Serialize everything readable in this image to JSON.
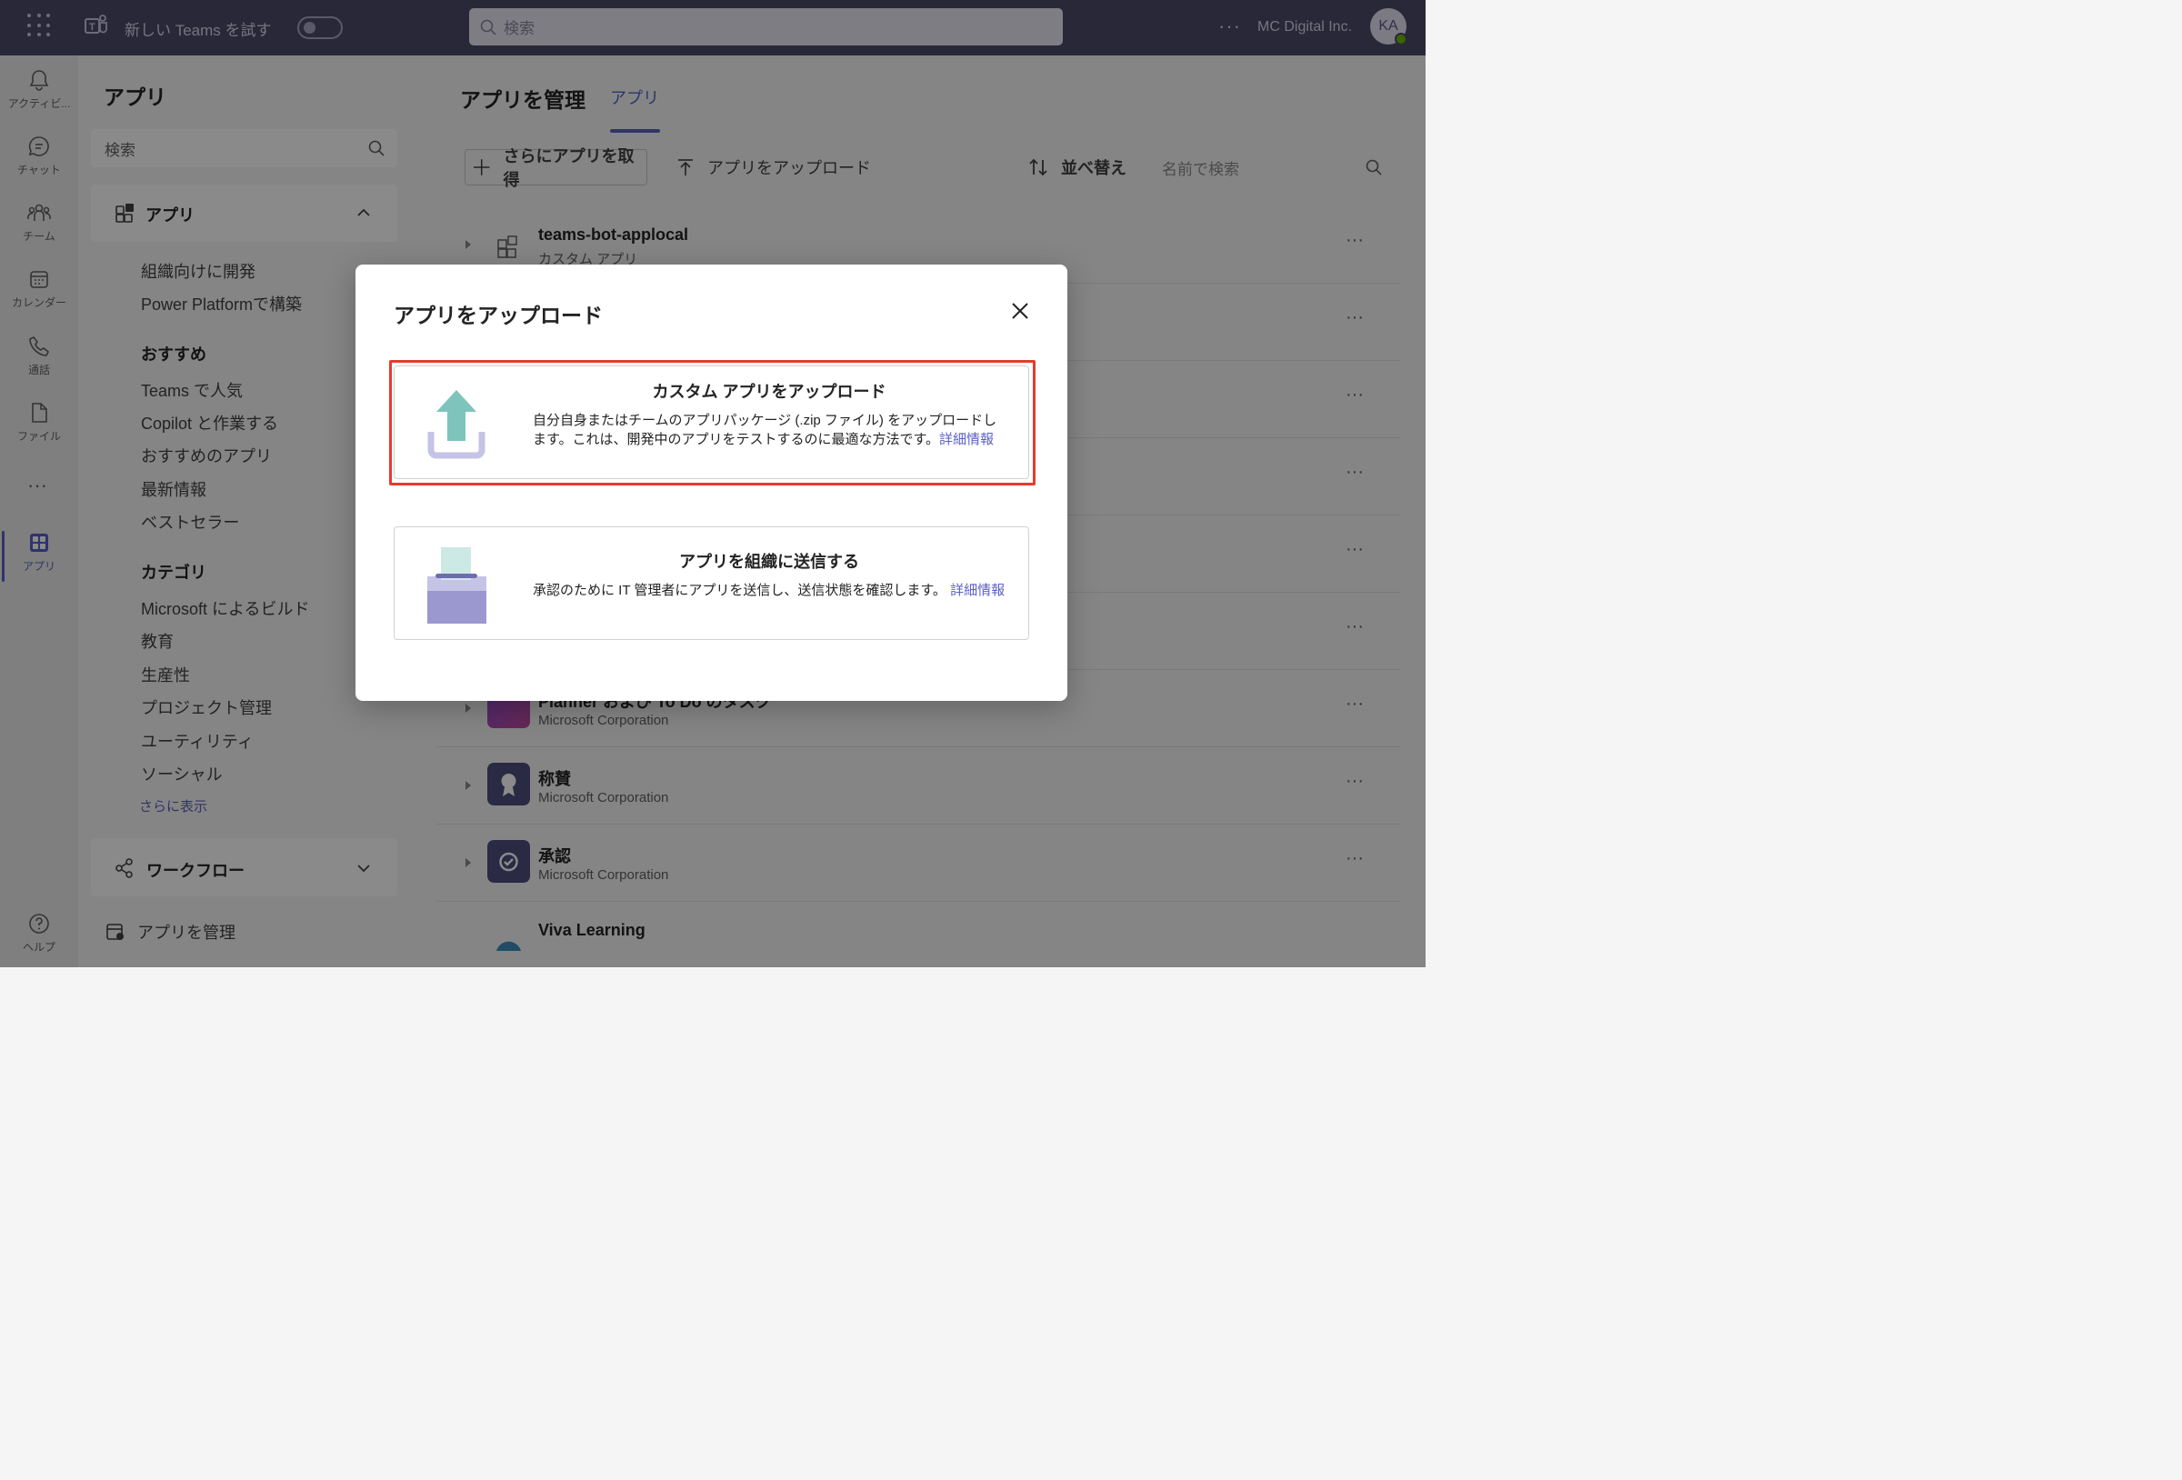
{
  "topbar": {
    "try_label": "新しい Teams を試す",
    "search_placeholder": "検索",
    "more": "···",
    "org_name": "MC Digital Inc.",
    "avatar_initials": "KA"
  },
  "rail": {
    "items": [
      {
        "label": "アクティビ...",
        "icon": "bell-icon"
      },
      {
        "label": "チャット",
        "icon": "chat-icon"
      },
      {
        "label": "チーム",
        "icon": "teams-icon"
      },
      {
        "label": "カレンダー",
        "icon": "calendar-icon"
      },
      {
        "label": "通話",
        "icon": "phone-icon"
      },
      {
        "label": "ファイル",
        "icon": "file-icon"
      },
      {
        "label": "アプリ",
        "icon": "apps-icon"
      }
    ],
    "more": "···",
    "help": "ヘルプ"
  },
  "leftpanel": {
    "title": "アプリ",
    "search_placeholder": "検索",
    "apps_section": "アプリ",
    "links_top": [
      "組織向けに開発",
      "Power Platformで構築"
    ],
    "recommended_heading": "おすすめ",
    "recommended": [
      "Teams で人気",
      "Copilot と作業する",
      "おすすめのアプリ",
      "最新情報",
      "ベストセラー"
    ],
    "category_heading": "カテゴリ",
    "categories": [
      "Microsoft によるビルド",
      "教育",
      "生産性",
      "プロジェクト管理",
      "ユーティリティ",
      "ソーシャル"
    ],
    "show_more": "さらに表示",
    "workflow": "ワークフロー",
    "manage": "アプリを管理"
  },
  "main": {
    "title": "アプリを管理",
    "tab": "アプリ",
    "get_more": "さらにアプリを取得",
    "upload": "アプリをアップロード",
    "sort": "並べ替え",
    "search_placeholder": "名前で検索",
    "rows": [
      {
        "name": "teams-bot-applocal",
        "sub": "カスタム アプリ"
      },
      {
        "name": "",
        "sub": ""
      },
      {
        "name": "",
        "sub": ""
      },
      {
        "name": "",
        "sub": ""
      },
      {
        "name": "",
        "sub": ""
      },
      {
        "name": "",
        "sub": ""
      },
      {
        "name": "Planner および To Do のタスク",
        "sub": "Microsoft Corporation"
      },
      {
        "name": "称賛",
        "sub": "Microsoft Corporation"
      },
      {
        "name": "承認",
        "sub": "Microsoft Corporation"
      },
      {
        "name": "Viva Learning",
        "sub": ""
      }
    ]
  },
  "dialog": {
    "title": "アプリをアップロード",
    "option1": {
      "heading": "カスタム アプリをアップロード",
      "desc": "自分自身またはチームのアプリパッケージ (.zip ファイル) をアップロードします。これは、開発中のアプリをテストするのに最適な方法です。",
      "link": "詳細情報"
    },
    "option2": {
      "heading": "アプリを組織に送信する",
      "desc": "承認のために IT 管理者にアプリを送信し、送信状態を確認します。",
      "link": "詳細情報"
    }
  },
  "colors": {
    "accent": "#5b5fc7",
    "topbar": "#4b4a6a",
    "highlight": "#e53c2e"
  }
}
